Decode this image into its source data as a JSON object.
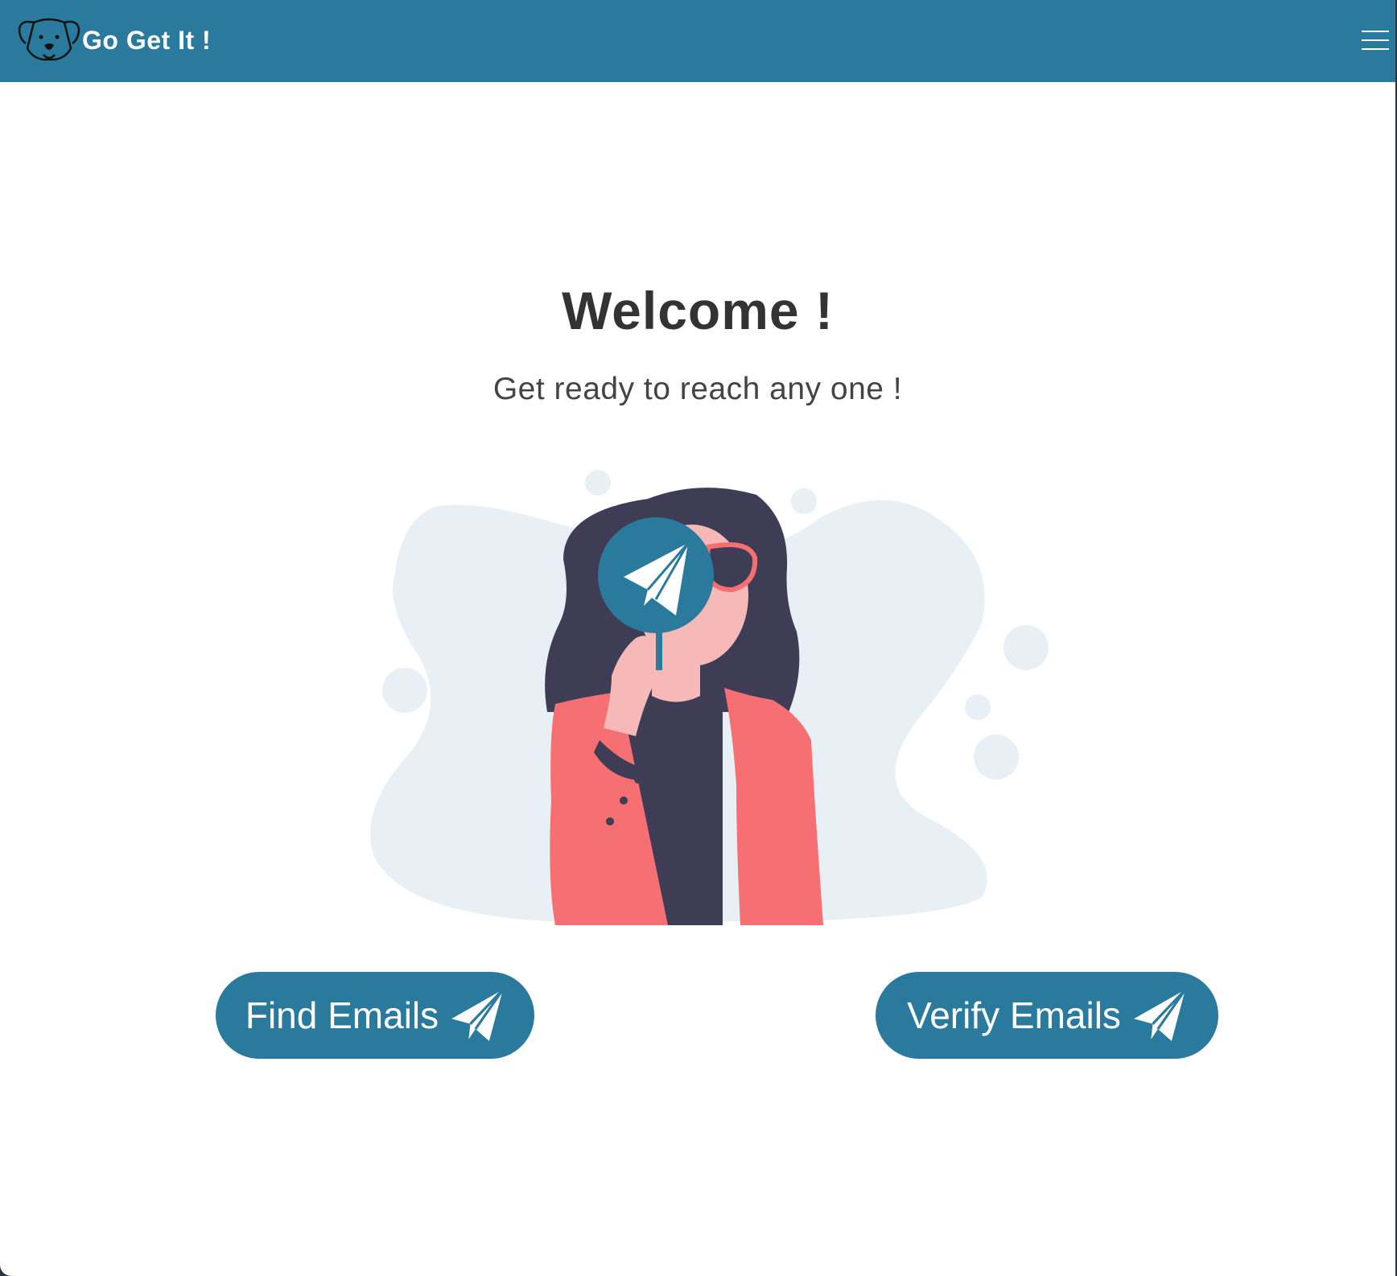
{
  "navbar": {
    "brand_name": "Go Get It !",
    "logo_icon": "dog-face-icon",
    "menu_icon": "hamburger-menu-icon",
    "background_color": "#2a7a9e"
  },
  "hero": {
    "title": "Welcome !",
    "subtitle": "Get ready to reach any one !",
    "illustration": "woman-holding-paper-plane-sign"
  },
  "actions": {
    "find_label": "Find Emails",
    "verify_label": "Verify Emails",
    "button_icon": "paper-plane-icon",
    "button_color": "#2a7a9e"
  }
}
